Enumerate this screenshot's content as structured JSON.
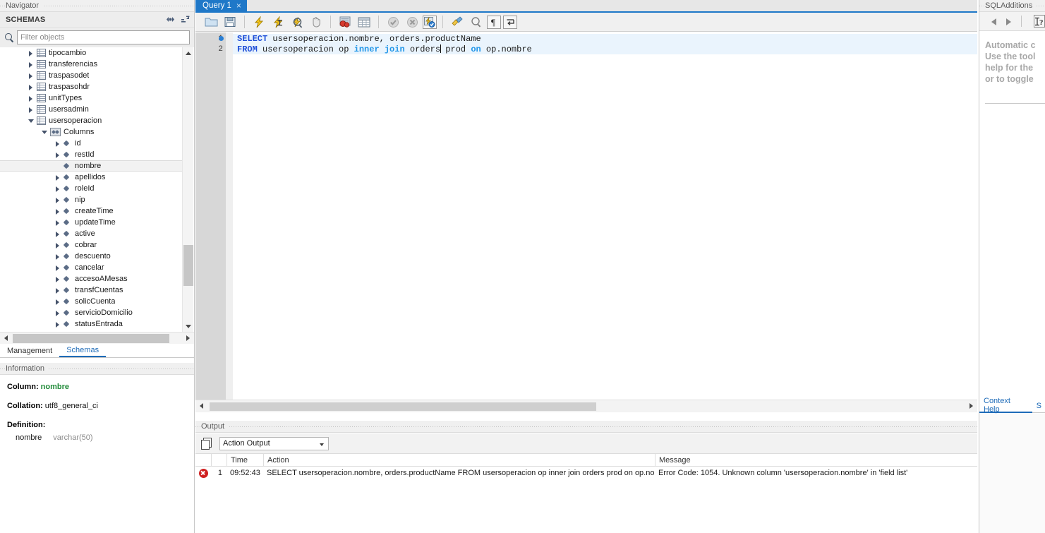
{
  "navigator": {
    "caption": "Navigator",
    "schemas_header": "SCHEMAS",
    "schemas_icons": [
      "refresh-icon",
      "collapse-all-icon"
    ],
    "filter": {
      "placeholder": "Filter objects",
      "value": "",
      "icon": "search-icon"
    },
    "tree": [
      {
        "label": "tipocambio",
        "indent": 0,
        "arrow": "right",
        "icon": "table-icon",
        "selected": false
      },
      {
        "label": "transferencias",
        "indent": 0,
        "arrow": "right",
        "icon": "table-icon",
        "selected": false
      },
      {
        "label": "traspasodet",
        "indent": 0,
        "arrow": "right",
        "icon": "table-icon",
        "selected": false
      },
      {
        "label": "traspasohdr",
        "indent": 0,
        "arrow": "right",
        "icon": "table-icon",
        "selected": false
      },
      {
        "label": "unitTypes",
        "indent": 0,
        "arrow": "right",
        "icon": "table-icon",
        "selected": false
      },
      {
        "label": "usersadmin",
        "indent": 0,
        "arrow": "right",
        "icon": "table-icon",
        "selected": false
      },
      {
        "label": "usersoperacion",
        "indent": 0,
        "arrow": "down",
        "icon": "table-icon",
        "selected": false
      },
      {
        "label": "Columns",
        "indent": 1,
        "arrow": "down",
        "icon": "columns-icon",
        "selected": false
      },
      {
        "label": "id",
        "indent": 2,
        "arrow": "right",
        "icon": "column-icon",
        "selected": false
      },
      {
        "label": "restId",
        "indent": 2,
        "arrow": "right",
        "icon": "column-icon",
        "selected": false
      },
      {
        "label": "nombre",
        "indent": 2,
        "arrow": "none",
        "icon": "column-icon",
        "selected": true
      },
      {
        "label": "apellidos",
        "indent": 2,
        "arrow": "right",
        "icon": "column-icon",
        "selected": false
      },
      {
        "label": "roleId",
        "indent": 2,
        "arrow": "right",
        "icon": "column-icon",
        "selected": false
      },
      {
        "label": "nip",
        "indent": 2,
        "arrow": "right",
        "icon": "column-icon",
        "selected": false
      },
      {
        "label": "createTime",
        "indent": 2,
        "arrow": "right",
        "icon": "column-icon",
        "selected": false
      },
      {
        "label": "updateTime",
        "indent": 2,
        "arrow": "right",
        "icon": "column-icon",
        "selected": false
      },
      {
        "label": "active",
        "indent": 2,
        "arrow": "right",
        "icon": "column-icon",
        "selected": false
      },
      {
        "label": "cobrar",
        "indent": 2,
        "arrow": "right",
        "icon": "column-icon",
        "selected": false
      },
      {
        "label": "descuento",
        "indent": 2,
        "arrow": "right",
        "icon": "column-icon",
        "selected": false
      },
      {
        "label": "cancelar",
        "indent": 2,
        "arrow": "right",
        "icon": "column-icon",
        "selected": false
      },
      {
        "label": "accesoAMesas",
        "indent": 2,
        "arrow": "right",
        "icon": "column-icon",
        "selected": false
      },
      {
        "label": "transfCuentas",
        "indent": 2,
        "arrow": "right",
        "icon": "column-icon",
        "selected": false
      },
      {
        "label": "solicCuenta",
        "indent": 2,
        "arrow": "right",
        "icon": "column-icon",
        "selected": false
      },
      {
        "label": "servicioDomicilio",
        "indent": 2,
        "arrow": "right",
        "icon": "column-icon",
        "selected": false
      },
      {
        "label": "statusEntrada",
        "indent": 2,
        "arrow": "right",
        "icon": "column-icon",
        "selected": false
      }
    ],
    "tabs": [
      {
        "label": "Management",
        "active": false
      },
      {
        "label": "Schemas",
        "active": true
      }
    ],
    "information": {
      "caption": "Information",
      "column_key": "Column:",
      "column_value": "nombre",
      "collation_key": "Collation:",
      "collation_value": "utf8_general_ci",
      "definition_key": "Definition:",
      "definition_name": "nombre",
      "definition_type": "varchar(50)"
    }
  },
  "editor": {
    "tab": {
      "label": "Query 1",
      "close": "×"
    },
    "toolbar": [
      {
        "name": "open-script-icon",
        "sep_after": false
      },
      {
        "name": "save-script-icon",
        "sep_after": true
      },
      {
        "name": "execute-statement-icon",
        "sep_after": false
      },
      {
        "name": "execute-current-statement-icon",
        "sep_after": false
      },
      {
        "name": "explain-query-icon",
        "sep_after": false
      },
      {
        "name": "stop-execution-icon",
        "sep_after": true
      },
      {
        "name": "toggle-stop-on-error-icon",
        "sep_after": false
      },
      {
        "name": "toggle-result-grid-icon",
        "sep_after": true
      },
      {
        "name": "commit-transaction-icon",
        "sep_after": false
      },
      {
        "name": "rollback-transaction-icon",
        "sep_after": false
      },
      {
        "name": "toggle-autocommit-icon",
        "sep_after": true
      },
      {
        "name": "beautify-query-icon",
        "sep_after": false
      },
      {
        "name": "find-icon",
        "sep_after": false
      },
      {
        "name": "toggle-invisible-chars-icon",
        "sep_after": false
      },
      {
        "name": "toggle-word-wrap-icon",
        "sep_after": false
      }
    ],
    "lines": [
      {
        "num": "1",
        "bookmark": true,
        "highlight": true,
        "tokens": [
          {
            "t": "SELECT",
            "k": "kw"
          },
          {
            "t": " usersoperacion.nombre, orders.productName",
            "k": "txt"
          }
        ]
      },
      {
        "num": "2",
        "bookmark": false,
        "highlight": true,
        "tokens": [
          {
            "t": "FROM",
            "k": "kw"
          },
          {
            "t": " usersoperacion op ",
            "k": "txt"
          },
          {
            "t": "inner",
            "k": "kw2"
          },
          {
            "t": " ",
            "k": "txt"
          },
          {
            "t": "join",
            "k": "kw2"
          },
          {
            "t": " orders",
            "k": "txt"
          },
          {
            "t": "|",
            "k": "caret"
          },
          {
            "t": " prod ",
            "k": "txt"
          },
          {
            "t": "on",
            "k": "kw2"
          },
          {
            "t": " op.nombre",
            "k": "txt"
          }
        ]
      }
    ]
  },
  "output": {
    "caption": "Output",
    "copy_icon": "copy-icon",
    "selector_value": "Action Output",
    "columns": [
      "",
      "",
      "Time",
      "Action",
      "Message"
    ],
    "rows": [
      {
        "status": "error",
        "num": "1",
        "time": "09:52:43",
        "action": "SELECT usersoperacion.nombre, orders.productName FROM usersoperacion op inner join orders prod on op.nomb...",
        "message": "Error Code: 1054. Unknown column 'usersoperacion.nombre' in 'field list'"
      }
    ]
  },
  "sql_additions": {
    "caption": "SQLAdditions",
    "toolbar": [
      "prev-icon",
      "next-icon",
      "context-help-icon"
    ],
    "help_text": [
      "Automatic c",
      "Use the tool",
      "help for the",
      "or to toggle"
    ],
    "tabs": [
      {
        "label": "Context Help",
        "active": true
      },
      {
        "label": "S",
        "active": false
      }
    ]
  },
  "colors": {
    "accent_blue": "#1f78c8",
    "tab_text": "#ffffff",
    "keyword": "#1f4fd8",
    "keyword_alt": "#2196e8",
    "error_red": "#cf2020",
    "green": "#1f8a37",
    "code_highlight": "#eaf4fd"
  }
}
